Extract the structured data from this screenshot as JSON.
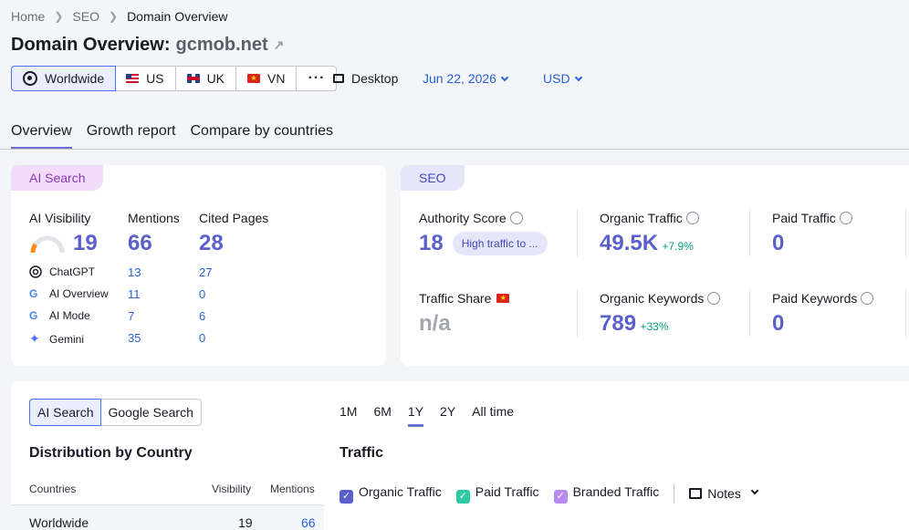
{
  "breadcrumb": {
    "home": "Home",
    "seo": "SEO",
    "current": "Domain Overview"
  },
  "title": {
    "prefix": "Domain Overview:",
    "domain": "gcmob.net"
  },
  "locations": [
    {
      "label": "Worldwide",
      "icon": "globe-icon"
    },
    {
      "label": "US",
      "icon": "us-flag-icon"
    },
    {
      "label": "UK",
      "icon": "uk-flag-icon"
    },
    {
      "label": "VN",
      "icon": "vn-flag-icon"
    }
  ],
  "device": "Desktop",
  "date": "Jun 22, 2026",
  "currency": "USD",
  "tabs": [
    "Overview",
    "Growth report",
    "Compare by countries"
  ],
  "ai_card": {
    "pill": "AI Search",
    "visibility_label": "AI Visibility",
    "visibility_value": "19",
    "visibility_gauge_fraction": 0.19,
    "mentions_label": "Mentions",
    "mentions_value": "66",
    "cited_label": "Cited Pages",
    "cited_value": "28",
    "rows": [
      {
        "name": "ChatGPT",
        "mentions": "13",
        "cited": "27"
      },
      {
        "name": "AI Overview",
        "mentions": "11",
        "cited": "0"
      },
      {
        "name": "AI Mode",
        "mentions": "7",
        "cited": "6"
      },
      {
        "name": "Gemini",
        "mentions": "35",
        "cited": "0"
      }
    ]
  },
  "seo_card": {
    "pill": "SEO",
    "authority_label": "Authority Score",
    "authority_value": "18",
    "authority_badge": "High traffic to ...",
    "organic_traffic_label": "Organic Traffic",
    "organic_traffic_value": "49.5K",
    "organic_traffic_change": "+7.9%",
    "paid_traffic_label": "Paid Traffic",
    "paid_traffic_value": "0",
    "traffic_share_label": "Traffic Share",
    "traffic_share_value": "n/a",
    "organic_keywords_label": "Organic Keywords",
    "organic_keywords_value": "789",
    "organic_keywords_change": "+33%",
    "paid_keywords_label": "Paid Keywords",
    "paid_keywords_value": "0"
  },
  "bottom": {
    "toggle": [
      "AI Search",
      "Google Search"
    ],
    "dist_title": "Distribution by Country",
    "columns": [
      "Countries",
      "Visibility",
      "Mentions"
    ],
    "rows": [
      {
        "country": "Worldwide",
        "visibility": "19",
        "mentions": "66"
      }
    ],
    "periods": [
      "1M",
      "6M",
      "1Y",
      "2Y",
      "All time"
    ],
    "traffic_title": "Traffic",
    "legend": [
      "Organic Traffic",
      "Paid Traffic",
      "Branded Traffic"
    ],
    "notes": "Notes"
  },
  "colors": {
    "accent": "#5a5fcc",
    "link": "#2761d8",
    "ai_pill": "#f3dcfb",
    "seo_pill": "#e6e6fb",
    "organic": "#5a5fcc",
    "paid": "#2dc8a4",
    "branded": "#b78af0"
  }
}
